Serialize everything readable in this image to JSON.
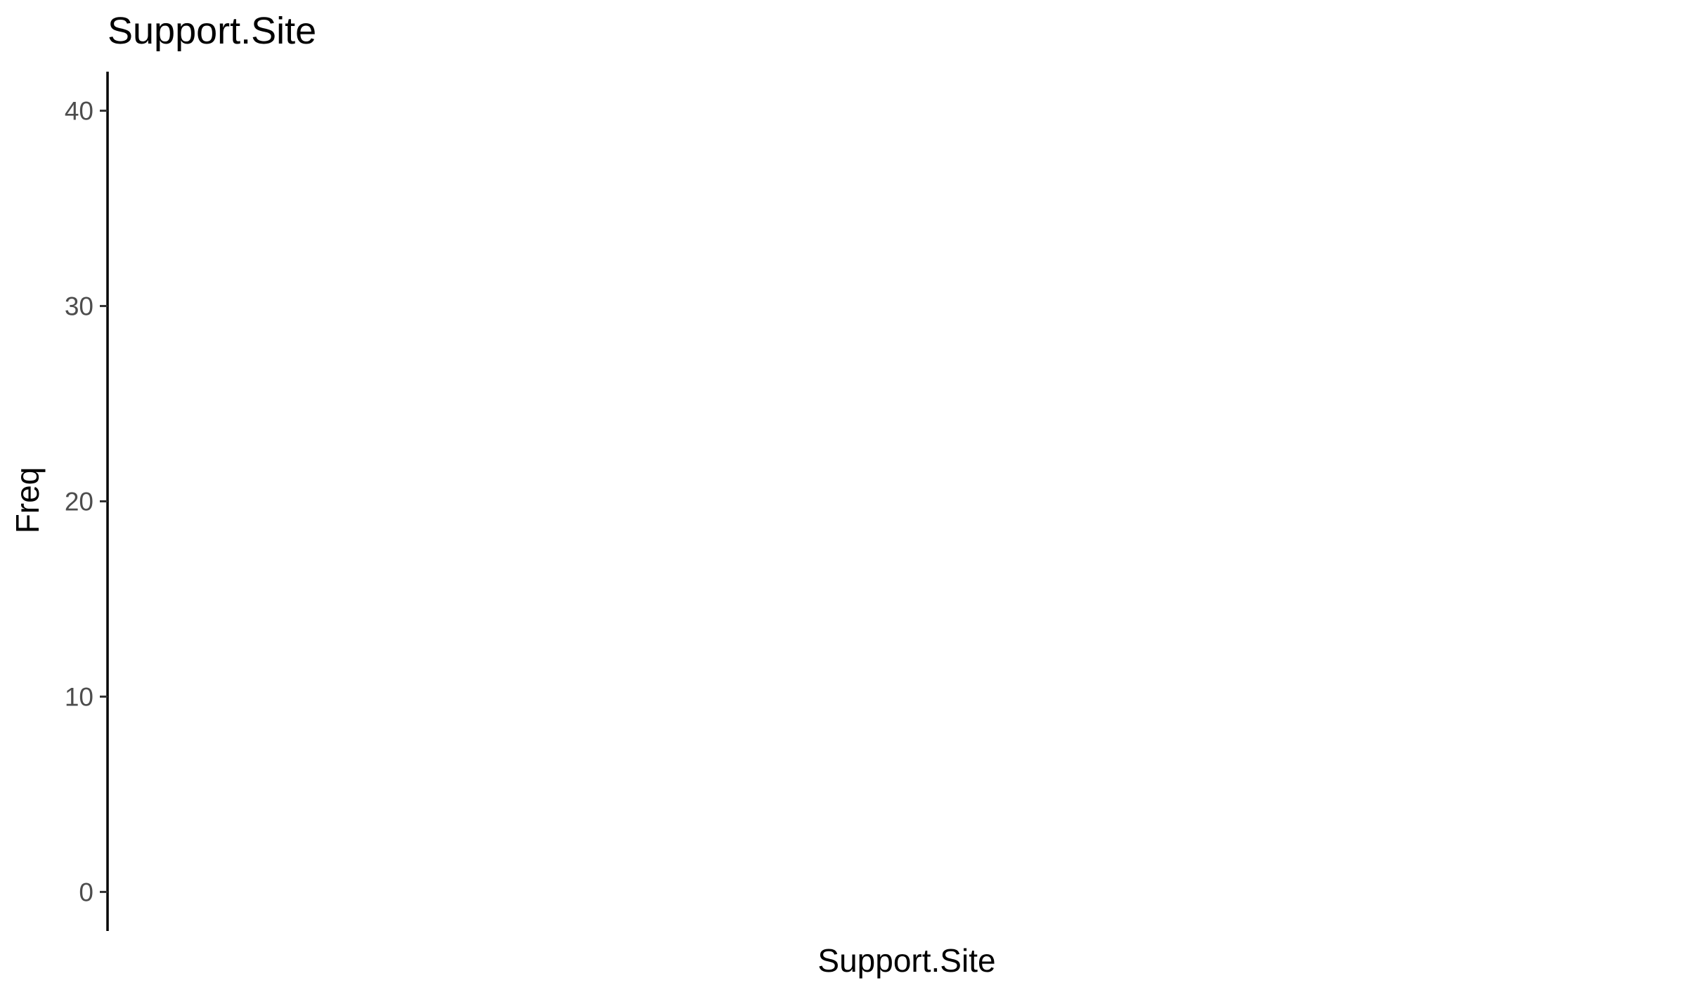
{
  "chart_data": {
    "type": "bar",
    "title": "Support.Site",
    "xlabel": "Support.Site",
    "ylabel": "Freq",
    "categories": [],
    "values": [],
    "ylim": [
      -2,
      42
    ],
    "yticks": [
      0,
      10,
      20,
      30,
      40
    ],
    "ytick_labels": [
      "0",
      "10",
      "20",
      "30",
      "40"
    ],
    "grid": false,
    "legend": "none"
  },
  "colors": {
    "background": "#ffffff",
    "axis": "#000000",
    "tick_label": "#4d4d4d"
  }
}
